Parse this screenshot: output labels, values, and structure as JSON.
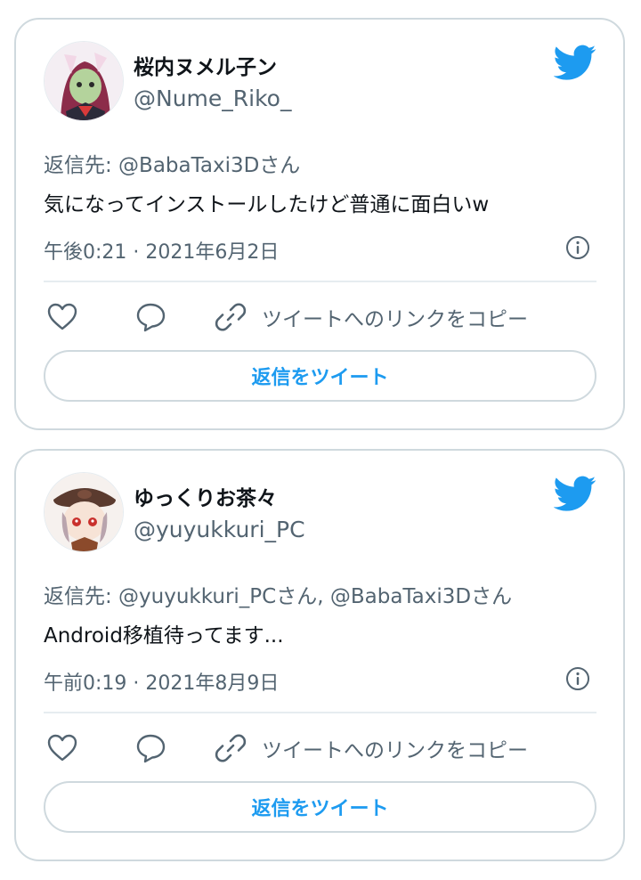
{
  "colors": {
    "accent": "#1d9bf0",
    "text_primary": "#0f1419",
    "text_secondary": "#536471",
    "border": "#cfd9de",
    "divider": "#e6ecf0"
  },
  "tweets": [
    {
      "display_name": "桜内ヌメル子ン",
      "handle": "@Nume_Riko_",
      "reply_to": "返信先: @BabaTaxi3Dさん",
      "text": "気になってインストールしたけど普通に面白いw",
      "timestamp": "午後0:21 · 2021年6月2日",
      "actions": {
        "like_icon": "heart-icon",
        "reply_icon": "speech-bubble-icon",
        "copy_link_icon": "link-icon",
        "copy_link_label": "ツイートへのリンクをコピー"
      },
      "reply_button_label": "返信をツイート"
    },
    {
      "display_name": "ゆっくりお茶々",
      "handle": "@yuyukkuri_PC",
      "reply_to": "返信先: @yuyukkuri_PCさん, @BabaTaxi3Dさん",
      "text": "Android移植待ってます...",
      "timestamp": "午前0:19 · 2021年8月9日",
      "actions": {
        "like_icon": "heart-icon",
        "reply_icon": "speech-bubble-icon",
        "copy_link_icon": "link-icon",
        "copy_link_label": "ツイートへのリンクをコピー"
      },
      "reply_button_label": "返信をツイート"
    }
  ]
}
